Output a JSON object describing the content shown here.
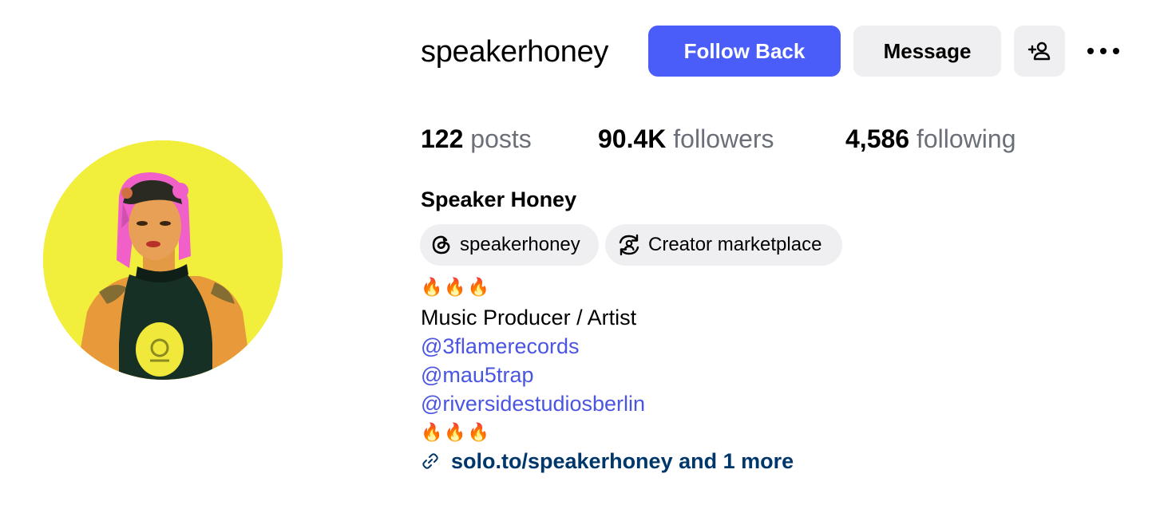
{
  "profile": {
    "username": "speakerhoney",
    "full_name": "Speaker Honey",
    "avatar_icon": "profile-photo"
  },
  "actions": {
    "follow_back_label": "Follow Back",
    "message_label": "Message",
    "add_user_icon": "person-plus-icon",
    "more_icon": "more-dots-icon"
  },
  "stats": {
    "posts_count": "122",
    "posts_label": "posts",
    "followers_count": "90.4K",
    "followers_label": "followers",
    "following_count": "4,586",
    "following_label": "following"
  },
  "chips": {
    "threads_label": "speakerhoney",
    "creator_label": "Creator marketplace"
  },
  "bio": {
    "emoji_top": "🔥🔥🔥",
    "line1": "Music Producer / Artist",
    "mention1": "@3flamerecords",
    "mention2": "@mau5trap",
    "mention3": "@riversidestudiosberlin",
    "emoji_bottom": "🔥🔥🔥"
  },
  "external_link": {
    "text": "solo.to/speakerhoney and 1 more"
  },
  "colors": {
    "primary_button": "#4a5df9",
    "secondary_button": "#efeff2",
    "mention_link": "#4a55e0",
    "external_link": "#00376b",
    "avatar_background": "#f2ef3c"
  }
}
